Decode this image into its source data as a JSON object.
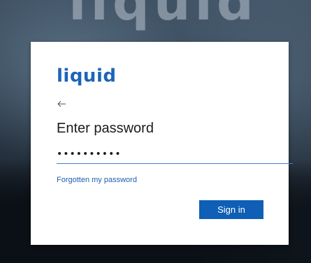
{
  "background": {
    "logo_text": "liquid"
  },
  "card": {
    "brand": "liquid",
    "brand_color": "#1e64b8",
    "back_icon": "arrow-left-icon",
    "title": "Enter password",
    "password_value": "••••••••••",
    "forgot_link": "Forgotten my password",
    "signin_label": "Sign in",
    "accent_color": "#0e5fb5"
  }
}
